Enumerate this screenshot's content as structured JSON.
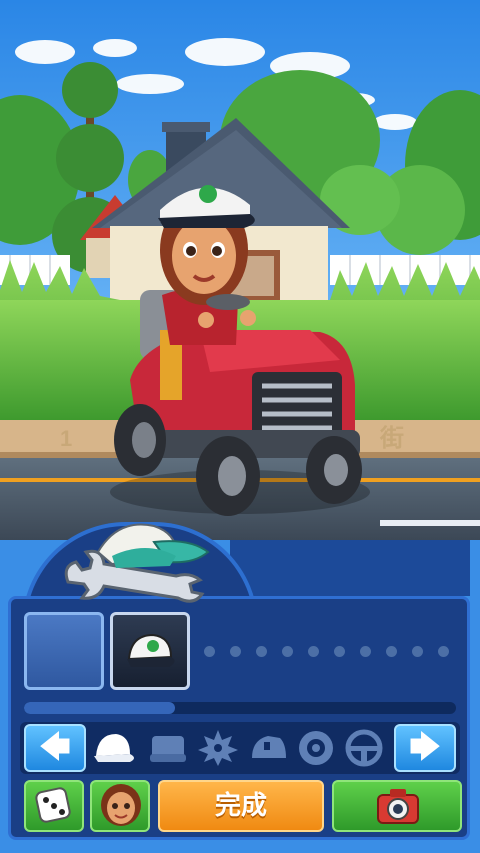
{
  "screen": "character-customization",
  "sign": {
    "left": "1",
    "right": "街"
  },
  "slots": [
    {
      "state": "empty"
    },
    {
      "item": "cap",
      "selected": true
    }
  ],
  "dots_count": 10,
  "progress": 0.35,
  "categories": [
    {
      "icon": "cap-icon",
      "active": true
    },
    {
      "icon": "seat-icon",
      "active": false
    },
    {
      "icon": "blade-icon",
      "active": false
    },
    {
      "icon": "mower-body-icon",
      "active": false
    },
    {
      "icon": "wheel-icon",
      "active": false
    },
    {
      "icon": "steering-wheel-icon",
      "active": false
    }
  ],
  "buttons": {
    "done_label": "完成",
    "prev_symbol": "🡄",
    "next_symbol": "🡆"
  },
  "colors": {
    "panel": "#1a3f86",
    "accent_orange": "#f08a12",
    "accent_green": "#3aae31",
    "arrow_blue": "#1f88e0"
  }
}
